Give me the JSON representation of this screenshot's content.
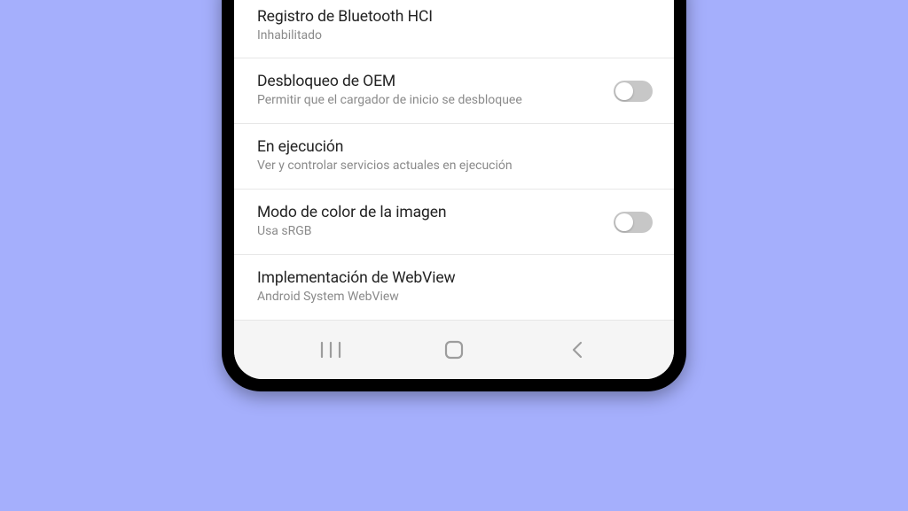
{
  "settings": {
    "bluetooth_hci": {
      "title": "Registro de Bluetooth HCI",
      "subtitle": "Inhabilitado"
    },
    "oem_unlock": {
      "title": "Desbloqueo de OEM",
      "subtitle": "Permitir que el cargador de inicio se desbloquee"
    },
    "running": {
      "title": "En ejecución",
      "subtitle": "Ver y controlar servicios actuales en ejecución"
    },
    "color_mode": {
      "title": "Modo de color de la imagen",
      "subtitle": "Usa sRGB"
    },
    "webview": {
      "title": "Implementación de WebView",
      "subtitle": "Android System WebView"
    }
  }
}
